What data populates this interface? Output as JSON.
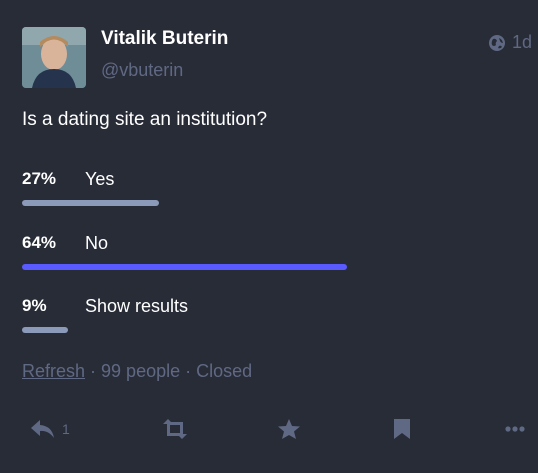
{
  "author": {
    "display_name": "Vitalik Buterin",
    "handle": "@vbuterin",
    "avatar_icon": "avatar-photo"
  },
  "status": {
    "timestamp": "1d",
    "visibility_icon": "globe-icon",
    "question": "Is a dating site an institution?"
  },
  "poll": {
    "options": [
      {
        "percent_label": "27%",
        "label": "Yes",
        "share": 0.27,
        "leading": false
      },
      {
        "percent_label": "64%",
        "label": "No",
        "share": 0.64,
        "leading": true
      },
      {
        "percent_label": "9%",
        "label": "Show results",
        "share": 0.09,
        "leading": false
      }
    ],
    "refresh_label": "Refresh",
    "voters": "99 people",
    "state": "Closed",
    "separator": " · "
  },
  "actions": {
    "reply_count": "1",
    "icons": [
      "reply-icon",
      "boost-icon",
      "favourite-icon",
      "bookmark-icon",
      "more-icon"
    ]
  },
  "colors": {
    "background": "#282c37",
    "muted": "#606984",
    "accent": "#595aff",
    "bar": "#8a9ab8"
  }
}
